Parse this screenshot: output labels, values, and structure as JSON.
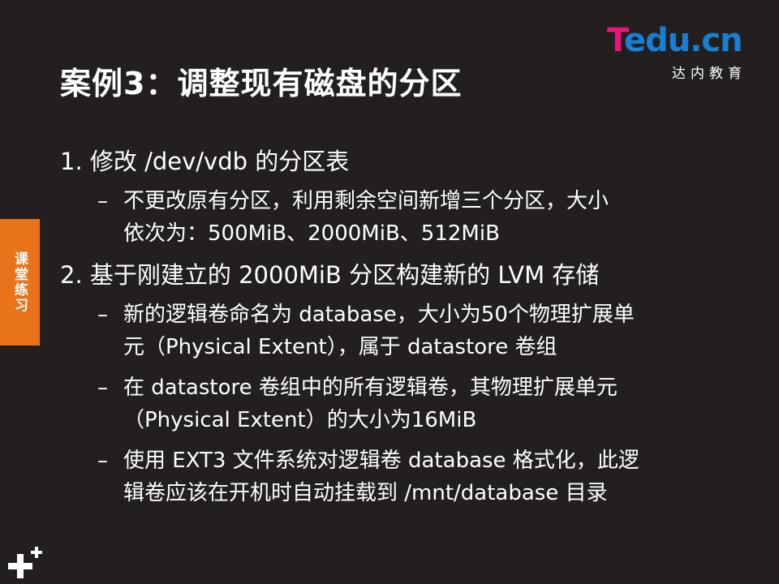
{
  "slide": {
    "title": "案例3：调整现有磁盘的分区",
    "side_tab": "课堂练习",
    "items": [
      {
        "text": "1. 修改 /dev/vdb 的分区表",
        "subs": [
          {
            "lines": [
              "不更改原有分区，利用剩余空间新增三个分区，大小",
              "依次为：500MiB、2000MiB、512MiB"
            ]
          }
        ]
      },
      {
        "text": "2. 基于刚建立的 2000MiB 分区构建新的 LVM 存储",
        "subs": [
          {
            "lines": [
              "新的逻辑卷命名为 database，大小为50个物理扩展单",
              "元（Physical Extent），属于 datastore 卷组"
            ]
          },
          {
            "lines": [
              "在 datastore 卷组中的所有逻辑卷，其物理扩展单元",
              "（Physical Extent）的大小为16MiB"
            ]
          },
          {
            "lines": [
              "使用 EXT3 文件系统对逻辑卷 database 格式化，此逻",
              "辑卷应该在开机时自动挂载到 /mnt/database 目录"
            ]
          }
        ]
      }
    ],
    "dash": "–"
  },
  "logo": {
    "t": "T",
    "rest": "edu.cn",
    "sub": "达内教育"
  },
  "colors": {
    "background": "#231f1f",
    "tab": "#e8731a",
    "logo_pink": "#e8157c",
    "logo_blue": "#1a7fd1"
  },
  "icons": {
    "corner": "plus-plus-icon"
  }
}
